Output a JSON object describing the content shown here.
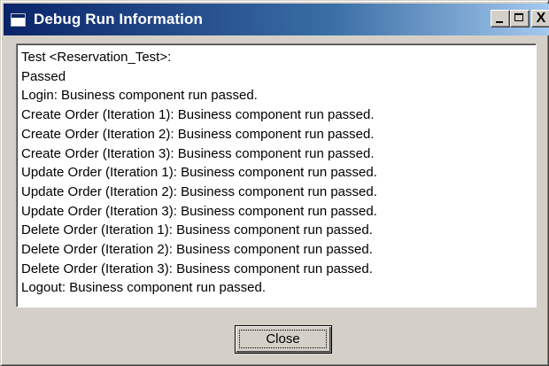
{
  "window": {
    "title": "Debug Run Information",
    "close_glyph": "X"
  },
  "log": {
    "lines": [
      "Test <Reservation_Test>:",
      "Passed",
      "Login: Business component run passed.",
      "Create Order (Iteration 1): Business component run passed.",
      "Create Order (Iteration 2): Business component run passed.",
      "Create Order (Iteration 3): Business component run passed.",
      "Update Order (Iteration 1): Business component run passed.",
      "Update Order (Iteration 2): Business component run passed.",
      "Update Order (Iteration 3): Business component run passed.",
      "Delete Order (Iteration 1): Business component run passed.",
      "Delete Order (Iteration 2): Business component run passed.",
      "Delete Order (Iteration 3): Business component run passed.",
      "Logout: Business component run passed."
    ]
  },
  "actions": {
    "close_label": "Close"
  },
  "colors": {
    "titlebar_start": "#0a246a",
    "titlebar_end": "#a6caf0",
    "dialog_face": "#d4d0c8"
  },
  "icons": {
    "title": "window-icon",
    "minimize": "minimize-icon",
    "maximize": "maximize-icon",
    "close": "close-icon"
  }
}
